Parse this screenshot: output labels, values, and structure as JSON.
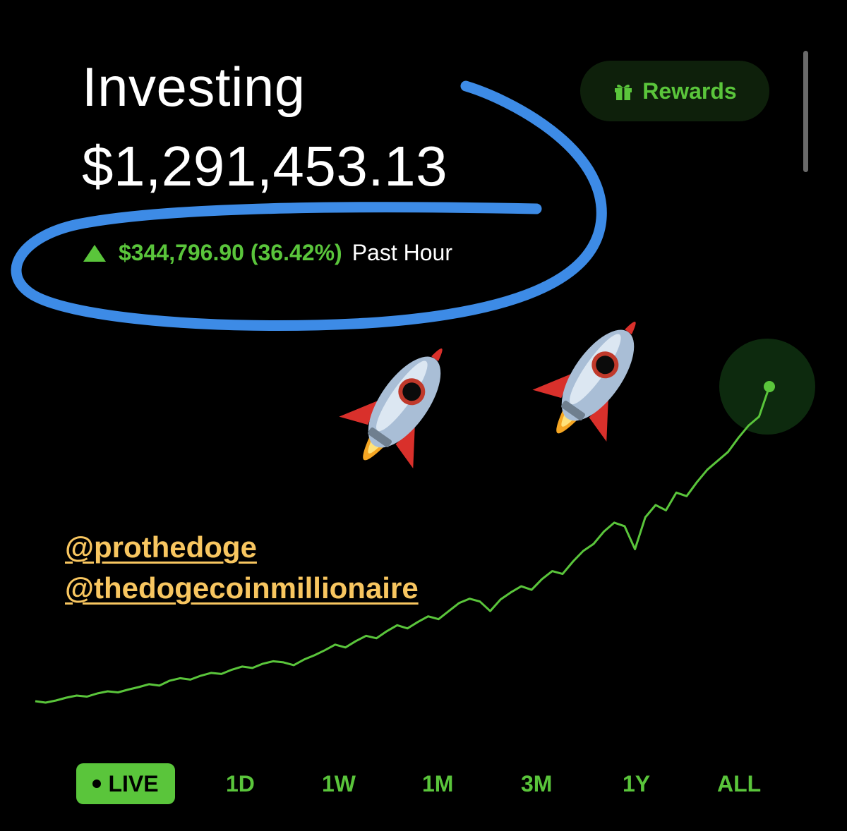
{
  "header": {
    "title": "Investing",
    "balance": "$1,291,453.13",
    "change_amount": "$344,796.90 (36.42%)",
    "change_period": "Past Hour",
    "trend": "up"
  },
  "rewards_button": {
    "label": "Rewards",
    "icon": "gift-icon"
  },
  "overlay": {
    "handles": [
      "@prothedoge",
      "@thedogecoinmillionaire"
    ],
    "rocket_icon": "rocket-icon",
    "rocket_count": 2
  },
  "time_ranges": [
    {
      "label": "LIVE",
      "active": true
    },
    {
      "label": "1D",
      "active": false
    },
    {
      "label": "1W",
      "active": false
    },
    {
      "label": "1M",
      "active": false
    },
    {
      "label": "3M",
      "active": false
    },
    {
      "label": "1Y",
      "active": false
    },
    {
      "label": "ALL",
      "active": false
    }
  ],
  "colors": {
    "accent": "#5ac53b",
    "background": "#000000",
    "annotation_circle": "#3d8be6",
    "handle_text": "#f8c660"
  },
  "chart_data": {
    "type": "line",
    "series": [
      {
        "values": [
          8,
          7.6,
          8.2,
          9,
          9.6,
          9.3,
          10.2,
          10.8,
          10.5,
          11.3,
          12,
          12.8,
          12.4,
          13.8,
          14.5,
          14.1,
          15.2,
          16,
          15.7,
          16.9,
          17.8,
          17.4,
          18.6,
          19.3,
          19,
          18.2,
          19.8,
          21,
          22.4,
          24,
          23.2,
          25,
          26.5,
          25.8,
          27.8,
          29.5,
          28.6,
          30.4,
          32,
          31.2,
          33.5,
          35.8,
          37,
          36.2,
          33.5,
          36.8,
          38.8,
          40.5,
          39.5,
          42.5,
          44.8,
          44,
          47.5,
          50.5,
          52.5,
          56,
          58.5,
          57.5,
          51,
          60,
          63.5,
          62,
          67,
          66,
          70,
          73.5,
          76,
          78.5,
          82.5,
          86,
          88.5,
          97
        ]
      }
    ],
    "last_point_highlighted": true
  }
}
